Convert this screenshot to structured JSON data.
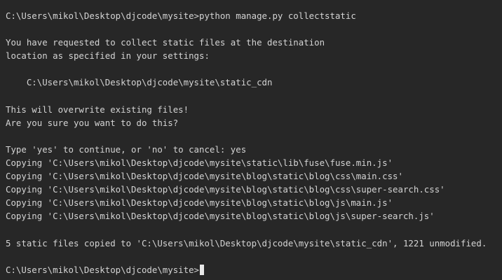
{
  "terminal": {
    "lines": [
      "C:\\Users\\mikol\\Desktop\\djcode\\mysite>python manage.py collectstatic",
      "",
      "You have requested to collect static files at the destination",
      "location as specified in your settings:",
      "",
      "    C:\\Users\\mikol\\Desktop\\djcode\\mysite\\static_cdn",
      "",
      "This will overwrite existing files!",
      "Are you sure you want to do this?",
      "",
      "Type 'yes' to continue, or 'no' to cancel: yes",
      "Copying 'C:\\Users\\mikol\\Desktop\\djcode\\mysite\\static\\lib\\fuse\\fuse.min.js'",
      "Copying 'C:\\Users\\mikol\\Desktop\\djcode\\mysite\\blog\\static\\blog\\css\\main.css'",
      "Copying 'C:\\Users\\mikol\\Desktop\\djcode\\mysite\\blog\\static\\blog\\css\\super-search.css'",
      "Copying 'C:\\Users\\mikol\\Desktop\\djcode\\mysite\\blog\\static\\blog\\js\\main.js'",
      "Copying 'C:\\Users\\mikol\\Desktop\\djcode\\mysite\\blog\\static\\blog\\js\\super-search.js'",
      "",
      "5 static files copied to 'C:\\Users\\mikol\\Desktop\\djcode\\mysite\\static_cdn', 1221 unmodified.",
      ""
    ],
    "prompt": "C:\\Users\\mikol\\Desktop\\djcode\\mysite>",
    "background_color": "#272727",
    "text_color": "#d4d4d4"
  }
}
